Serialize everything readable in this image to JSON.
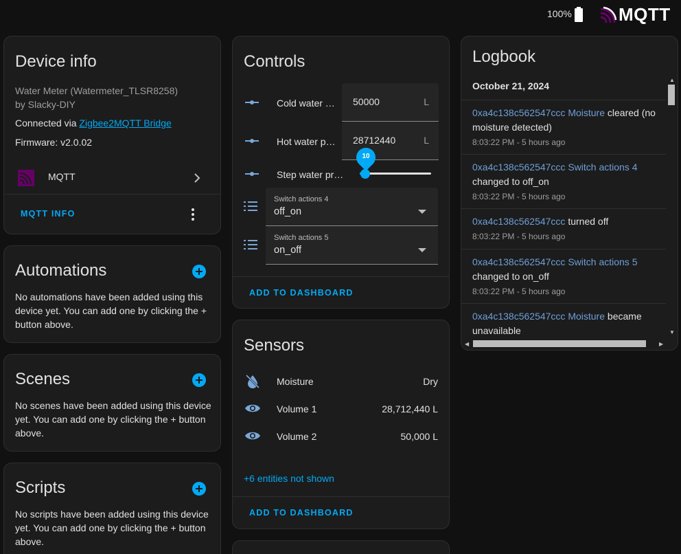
{
  "topbar": {
    "battery": "100%",
    "logo_text": "MQTT"
  },
  "device_info": {
    "title": "Device info",
    "model": "Water Meter (Watermeter_TLSR8258)",
    "manufacturer": "by Slacky-DIY",
    "connected_prefix": "Connected via ",
    "connected_link": "Zigbee2MQTT Bridge",
    "firmware": "Firmware: v2.0.02",
    "integration": "MQTT",
    "action": "MQTT INFO"
  },
  "automations": {
    "title": "Automations",
    "text": "No automations have been added using this device yet. You can add one by clicking the + button above."
  },
  "scenes": {
    "title": "Scenes",
    "text": "No scenes have been added using this device yet. You can add one by clicking the + button above."
  },
  "scripts": {
    "title": "Scripts",
    "text": "No scripts have been added using this device yet. You can add one by clicking the + button above."
  },
  "controls": {
    "title": "Controls",
    "cold": {
      "label": "Cold water …",
      "value": "50000",
      "unit": "L"
    },
    "hot": {
      "label": "Hot water p…",
      "value": "28712440",
      "unit": "L"
    },
    "step": {
      "label": "Step water pr…",
      "value": "10"
    },
    "switch4": {
      "label": "Switch actions 4",
      "value": "off_on"
    },
    "switch5": {
      "label": "Switch actions 5",
      "value": "on_off"
    },
    "action": "ADD TO DASHBOARD"
  },
  "sensors": {
    "title": "Sensors",
    "items": [
      {
        "label": "Moisture",
        "value": "Dry",
        "icon": "water-off-icon"
      },
      {
        "label": "Volume 1",
        "value": "28,712,440 L",
        "icon": "eye-icon"
      },
      {
        "label": "Volume 2",
        "value": "50,000 L",
        "icon": "eye-icon"
      }
    ],
    "more": "+6 entities not shown",
    "action": "ADD TO DASHBOARD"
  },
  "logbook": {
    "title": "Logbook",
    "date": "October 21, 2024",
    "entries": [
      {
        "entity": "0xa4c138c562547ccc Moisture",
        "message": " cleared (no moisture detected)",
        "time": "8:03:22 PM - 5 hours ago"
      },
      {
        "entity": "0xa4c138c562547ccc Switch actions 4",
        "message": " changed to off_on",
        "time": "8:03:22 PM - 5 hours ago"
      },
      {
        "entity": "0xa4c138c562547ccc",
        "message": " turned off",
        "time": "8:03:22 PM - 5 hours ago"
      },
      {
        "entity": "0xa4c138c562547ccc Switch actions 5",
        "message": " changed to on_off",
        "time": "8:03:22 PM - 5 hours ago"
      },
      {
        "entity": "0xa4c138c562547ccc Moisture",
        "message": " became unavailable",
        "time": ""
      }
    ]
  },
  "colors": {
    "accent": "#03a9f4",
    "background": "#111111",
    "card": "#1c1c1c",
    "mqtt_purple": "#660066"
  }
}
